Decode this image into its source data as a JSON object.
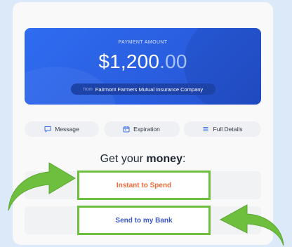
{
  "payment": {
    "label": "PAYMENT AMOUNT",
    "amount_main": "$1,200",
    "amount_cents": ".00",
    "from_label": "from",
    "company": "Fairmont Farmers Mutual Insurance Company"
  },
  "tabs": [
    {
      "label": "Message",
      "icon": "message-icon"
    },
    {
      "label": "Expiration",
      "icon": "calendar-icon"
    },
    {
      "label": "Full Details",
      "icon": "list-icon"
    }
  ],
  "heading": {
    "prefix": "Get your ",
    "emphasis": "money",
    "suffix": ":"
  },
  "actions": {
    "instant_label": "Instant to Spend",
    "bank_label": "Send to my Bank"
  },
  "colors": {
    "banner_blue": "#2f6cf0",
    "highlight_green": "#6fbf3f",
    "instant_orange": "#f06a3a",
    "bank_blue": "#3b57c8",
    "arrow_green": "#6fbf3f"
  }
}
